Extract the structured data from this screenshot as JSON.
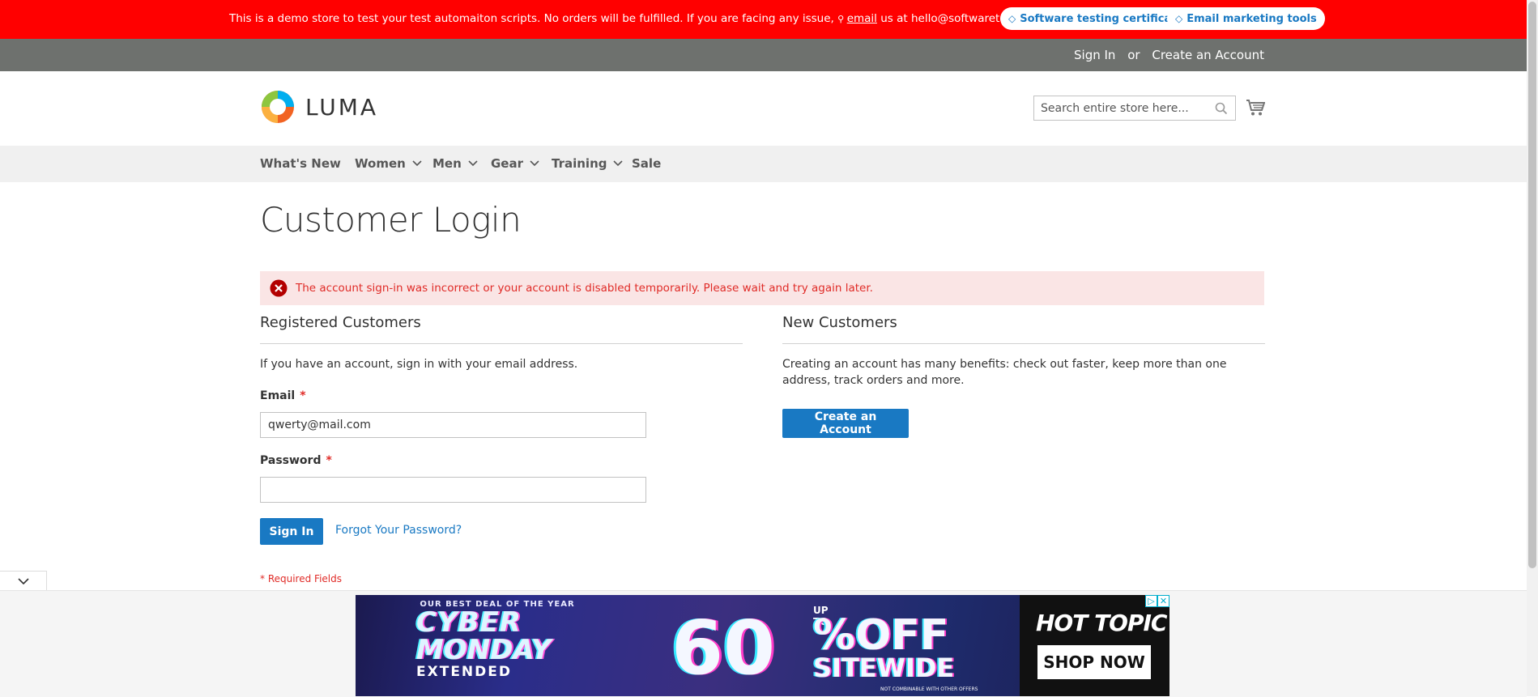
{
  "demo_banner": {
    "text_before": "This is a demo store to test your test automaiton scripts. No orders will be fulfilled. If you are facing any issue, ",
    "email_link": "email",
    "text_after": " us at hello@softwaretestingboard.com.",
    "pill1": "Software testing certification",
    "pill2": "Email marketing tools",
    "color": "#ff0000"
  },
  "panel": {
    "sign_in": "Sign In",
    "or": "or",
    "create_account": "Create an Account"
  },
  "header": {
    "logo_text": "LUMA",
    "search_placeholder": "Search entire store here...",
    "search_icon": "search-icon",
    "cart_icon": "cart-icon"
  },
  "nav": {
    "items": [
      {
        "label": "What's New"
      },
      {
        "label": "Women"
      },
      {
        "label": "Men"
      },
      {
        "label": "Gear"
      },
      {
        "label": "Training"
      },
      {
        "label": "Sale"
      }
    ]
  },
  "main": {
    "title": "Customer Login",
    "error": "The account sign-in was incorrect or your account is disabled temporarily. Please wait and try again later.",
    "registered": {
      "title": "Registered Customers",
      "intro": "If you have an account, sign in with your email address.",
      "email_label": "Email",
      "email_value": "qwerty@mail.com",
      "password_label": "Password",
      "password_value": "",
      "required_mark": "*",
      "sign_in_button": "Sign In",
      "forgot_link": "Forgot Your Password?",
      "required_fields": "* Required Fields"
    },
    "new_customers": {
      "title": "New Customers",
      "text": "Creating an account has many benefits: check out faster, keep more than one address, track orders and more.",
      "create_button": "Create an Account"
    }
  },
  "ad": {
    "top_line": "OUR BEST DEAL OF THE YEAR",
    "cyber": "CYBER",
    "monday": "MONDAY",
    "extended": "EXTENDED",
    "up_to": "UP TO",
    "sixty": "60",
    "percent_off": "%OFF",
    "sitewide": "SITEWIDE",
    "fine_print": "NOT COMBINABLE WITH OTHER OFFERS",
    "brand": "HOT TOPIC",
    "shop_now": "SHOP NOW",
    "adchoices": "▷",
    "close": "✕"
  },
  "colors": {
    "accent": "#1979c3",
    "error": "#e02b27",
    "error_bg": "#fae5e5",
    "panel_bg": "#6e716e",
    "nav_bg": "#f0f0f0"
  }
}
